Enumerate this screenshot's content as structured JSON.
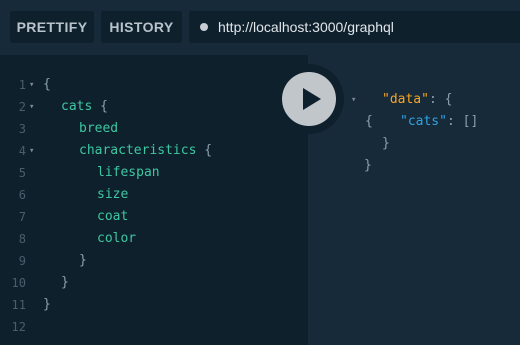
{
  "toolbar": {
    "prettify_label": "PRETTIFY",
    "history_label": "HISTORY",
    "url": "http://localhost:3000/graphql"
  },
  "editor": {
    "line_numbers": [
      "1",
      "2",
      "3",
      "4",
      "5",
      "6",
      "7",
      "8",
      "9",
      "10",
      "11",
      "12"
    ],
    "lines": {
      "l1": "{",
      "l2_field": "cats",
      "l2_brace": " {",
      "l3": "breed",
      "l4_field": "characteristics",
      "l4_brace": " {",
      "l5": "lifespan",
      "l6": "size",
      "l7": "coat",
      "l8": "color",
      "l9": "}",
      "l10": "}",
      "l11": "}"
    },
    "fold_marker": "▾"
  },
  "result": {
    "fold_marker": "▾",
    "open": "{",
    "data_key": "\"data\"",
    "data_sep": ": {",
    "cats_key": "\"cats\"",
    "cats_val": ": []",
    "inner_close": "}",
    "outer_close": "}"
  },
  "colors": {
    "field": "#3ec7a2",
    "key_orange": "#f5a524",
    "key_blue": "#2fa3e0",
    "background": "#0f202d",
    "panel": "#172a3a"
  },
  "icons": {
    "execute": "play-icon",
    "url_status": "dot-icon"
  }
}
